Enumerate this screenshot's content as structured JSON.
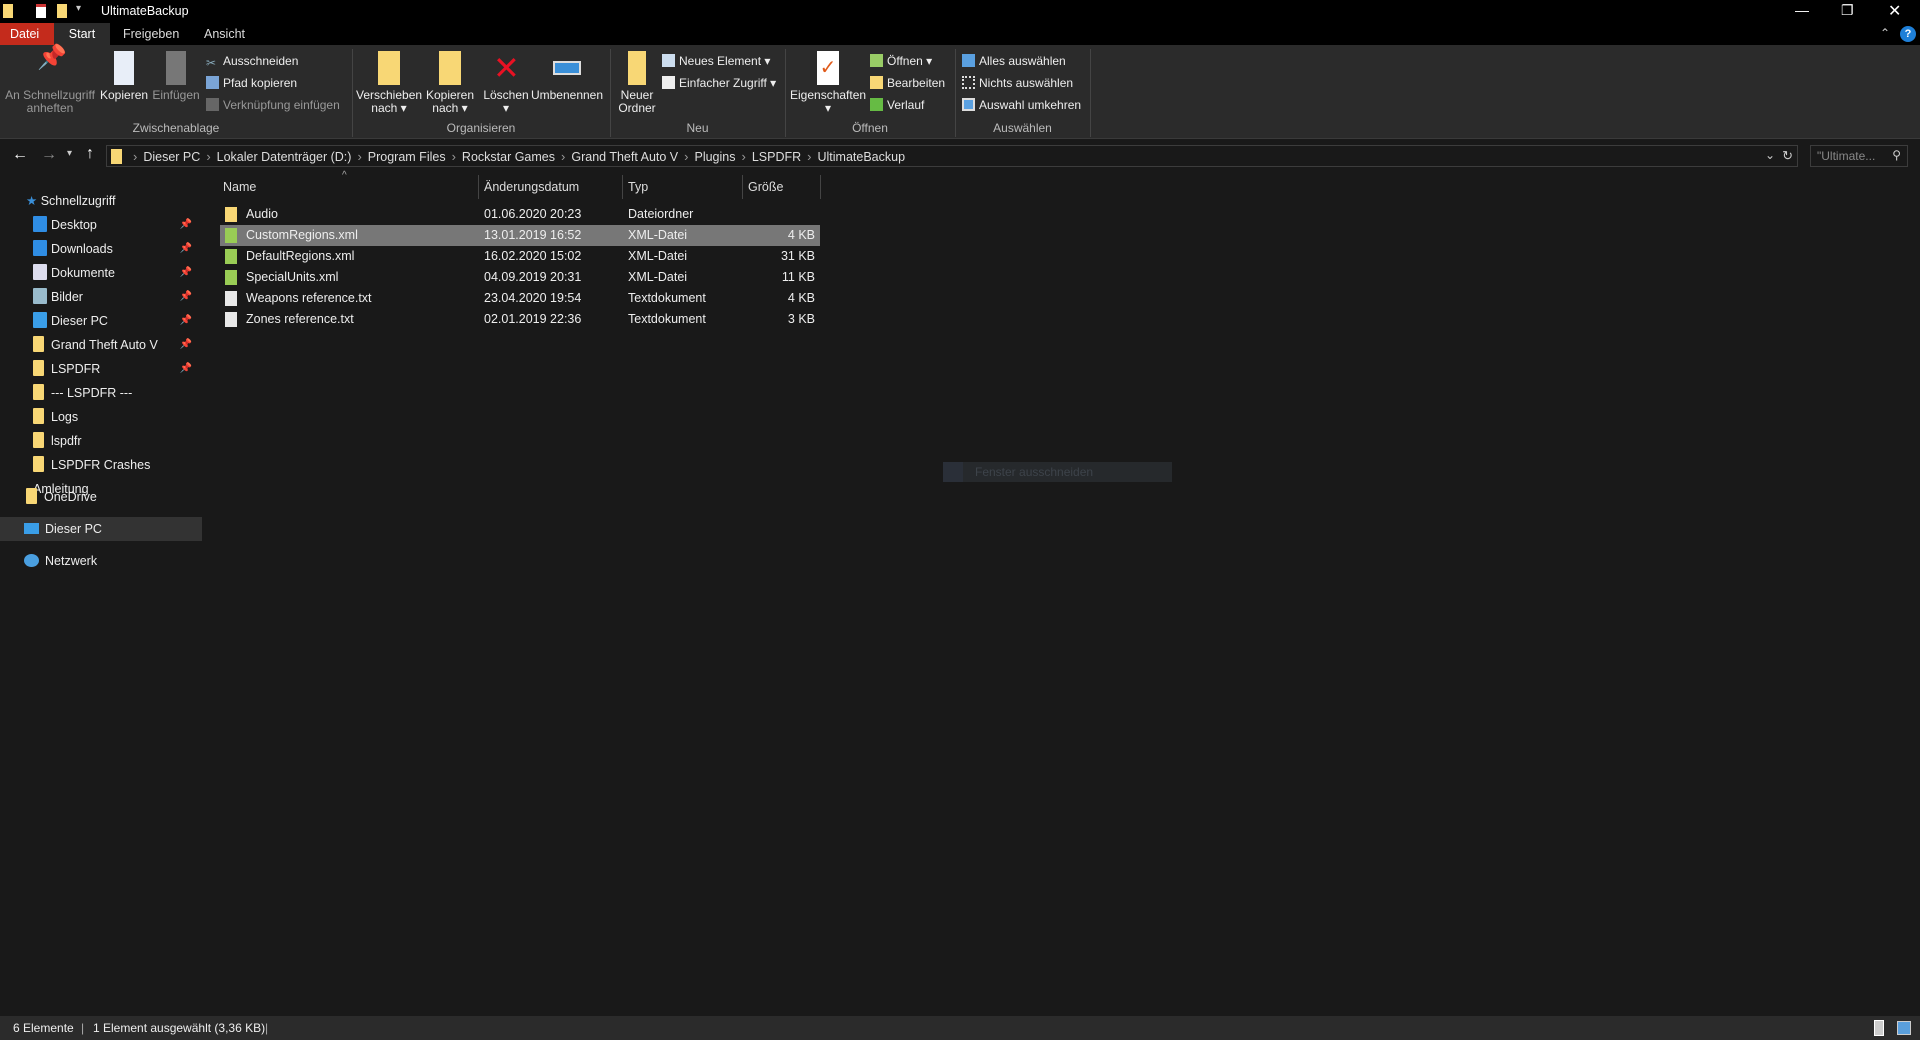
{
  "window": {
    "title": "UltimateBackup"
  },
  "tabs": [
    "Datei",
    "Start",
    "Freigeben",
    "Ansicht"
  ],
  "ribbon": {
    "clipboard": {
      "pin": "An Schnellzugriff anheften",
      "copy": "Kopieren",
      "paste": "Einfügen",
      "cut": "Ausschneiden",
      "copy_path": "Pfad kopieren",
      "paste_shortcut": "Verknüpfung einfügen",
      "label": "Zwischenablage"
    },
    "organize": {
      "move": "Verschieben nach",
      "copy_to": "Kopieren nach",
      "delete": "Löschen",
      "rename": "Umbenennen",
      "label": "Organisieren"
    },
    "new": {
      "new_folder": "Neuer Ordner",
      "new_item": "Neues Element",
      "easy_access": "Einfacher Zugriff",
      "label": "Neu"
    },
    "open": {
      "properties": "Eigenschaften",
      "open": "Öffnen",
      "edit": "Bearbeiten",
      "history": "Verlauf",
      "label": "Öffnen"
    },
    "select": {
      "all": "Alles auswählen",
      "none": "Nichts auswählen",
      "invert": "Auswahl umkehren",
      "label": "Auswählen"
    }
  },
  "breadcrumb": [
    "Dieser PC",
    "Lokaler Datenträger (D:)",
    "Program Files",
    "Rockstar Games",
    "Grand Theft Auto V",
    "Plugins",
    "LSPDFR",
    "UltimateBackup"
  ],
  "search": {
    "placeholder": "\"Ultimate..."
  },
  "sidebar": {
    "quick_access": "Schnellzugriff",
    "items": [
      {
        "label": "Desktop",
        "icon": "desktop-icon",
        "pinned": true
      },
      {
        "label": "Downloads",
        "icon": "download-icon",
        "pinned": true
      },
      {
        "label": "Dokumente",
        "icon": "documents-icon",
        "pinned": true
      },
      {
        "label": "Bilder",
        "icon": "pictures-icon",
        "pinned": true
      },
      {
        "label": "Dieser PC",
        "icon": "pc-icon",
        "pinned": true
      },
      {
        "label": "Grand Theft Auto V",
        "icon": "folder-icon",
        "pinned": true
      },
      {
        "label": "LSPDFR",
        "icon": "folder-icon",
        "pinned": true
      },
      {
        "label": "--- LSPDFR ---",
        "icon": "folder-icon",
        "pinned": false
      },
      {
        "label": "Logs",
        "icon": "folder-icon",
        "pinned": false
      },
      {
        "label": "lspdfr",
        "icon": "folder-icon",
        "pinned": false
      },
      {
        "label": "LSPDFR Crashes Amleitung",
        "icon": "folder-icon",
        "pinned": false
      }
    ],
    "onedrive": "OneDrive",
    "this_pc": "Dieser PC",
    "network": "Netzwerk"
  },
  "columns": {
    "name": "Name",
    "date": "Änderungsdatum",
    "type": "Typ",
    "size": "Größe"
  },
  "files": [
    {
      "name": "Audio",
      "date": "01.06.2020 20:23",
      "type": "Dateiordner",
      "size": "",
      "kind": "folder"
    },
    {
      "name": "CustomRegions.xml",
      "date": "13.01.2019 16:52",
      "type": "XML-Datei",
      "size": "4 KB",
      "kind": "xml",
      "selected": true
    },
    {
      "name": "DefaultRegions.xml",
      "date": "16.02.2020 15:02",
      "type": "XML-Datei",
      "size": "31 KB",
      "kind": "xml"
    },
    {
      "name": "SpecialUnits.xml",
      "date": "04.09.2019 20:31",
      "type": "XML-Datei",
      "size": "11 KB",
      "kind": "xml"
    },
    {
      "name": "Weapons reference.txt",
      "date": "23.04.2020 19:54",
      "type": "Textdokument",
      "size": "4 KB",
      "kind": "txt"
    },
    {
      "name": "Zones reference.txt",
      "date": "02.01.2019 22:36",
      "type": "Textdokument",
      "size": "3 KB",
      "kind": "txt"
    }
  ],
  "tooltip": "Fenster ausschneiden",
  "status": {
    "count": "6 Elemente",
    "selection": "1 Element ausgewählt (3,36 KB)"
  }
}
